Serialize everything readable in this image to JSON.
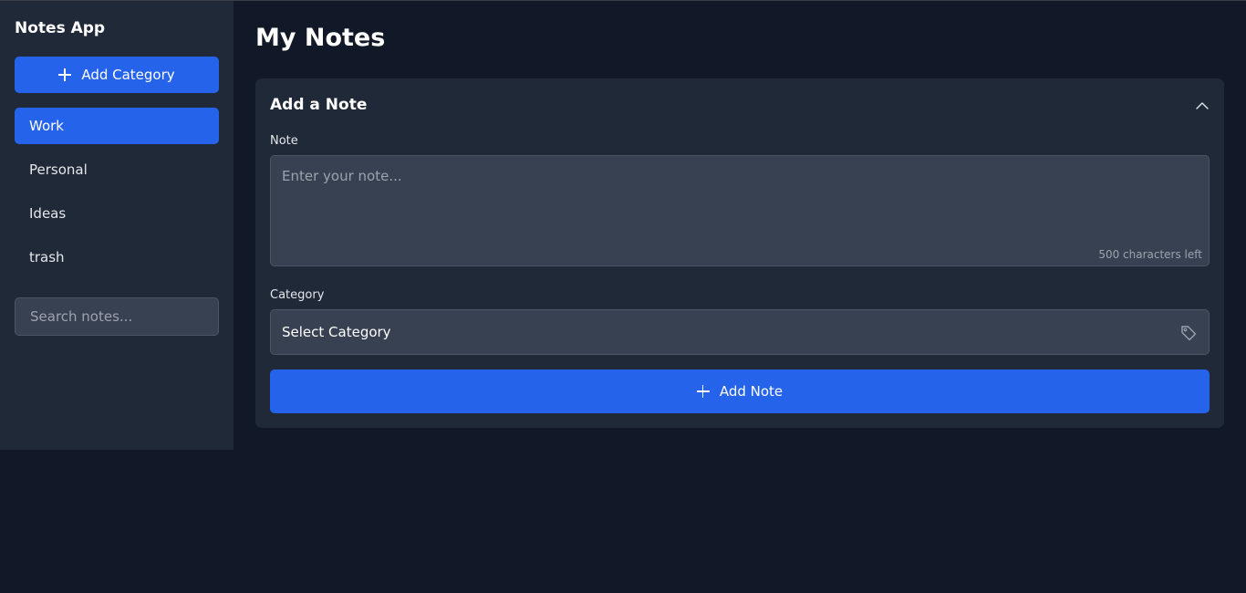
{
  "app": {
    "title": "Notes App"
  },
  "sidebar": {
    "add_category_label": "Add Category",
    "categories": [
      {
        "label": "Work",
        "active": true
      },
      {
        "label": "Personal",
        "active": false
      },
      {
        "label": "Ideas",
        "active": false
      },
      {
        "label": "trash",
        "active": false
      }
    ],
    "search": {
      "placeholder": "Search notes...",
      "value": ""
    }
  },
  "main": {
    "title": "My Notes",
    "add_note_card": {
      "title": "Add a Note",
      "collapse_icon": "chevron-up-icon",
      "note_label": "Note",
      "note_placeholder": "Enter your note...",
      "char_count": "500 characters left",
      "category_label": "Category",
      "category_value": "Select Category",
      "category_icon": "tag-icon",
      "add_button_label": "Add Note"
    }
  },
  "colors": {
    "background": "#111827",
    "panel": "#1f2937",
    "input": "#374151",
    "accent": "#2563eb"
  }
}
